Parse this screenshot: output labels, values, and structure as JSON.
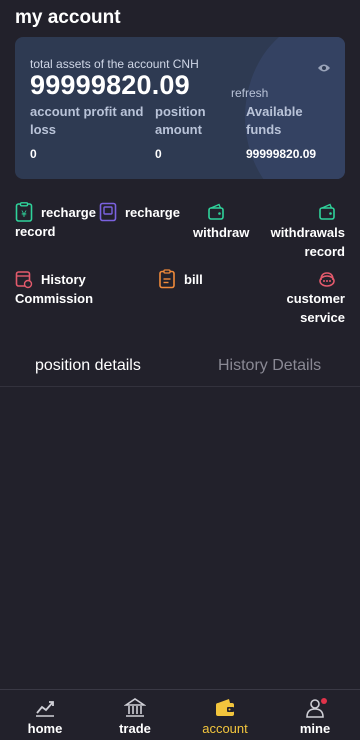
{
  "page": {
    "title": "my account"
  },
  "card": {
    "label": "total assets of the account CNH",
    "amount": "99999820.09",
    "refresh": "refresh",
    "eye_icon": "eye-icon",
    "stats": [
      {
        "label": "account profit and loss",
        "value": "0"
      },
      {
        "label": "position amount",
        "value": "0"
      },
      {
        "label": "Available funds",
        "value": "99999820.09"
      }
    ]
  },
  "menu": {
    "recharge_record": "recharge record",
    "recharge": "recharge",
    "withdraw": "withdraw",
    "withdrawals_record": "withdrawals record",
    "history_commission": "History Commission",
    "bill": "bill",
    "customer_service": "customer service"
  },
  "tabs": {
    "position_details": "position details",
    "history_details": "History Details"
  },
  "nav": {
    "home": "home",
    "trade": "trade",
    "account": "account",
    "mine": "mine"
  },
  "colors": {
    "background": "#22212b",
    "card": "#2e3a52",
    "accent_active": "#f2c53d",
    "green_icon": "#2fd39b",
    "purple_icon": "#7b62e0",
    "red_icon": "#e35a6c",
    "orange_icon": "#f08a3a"
  }
}
